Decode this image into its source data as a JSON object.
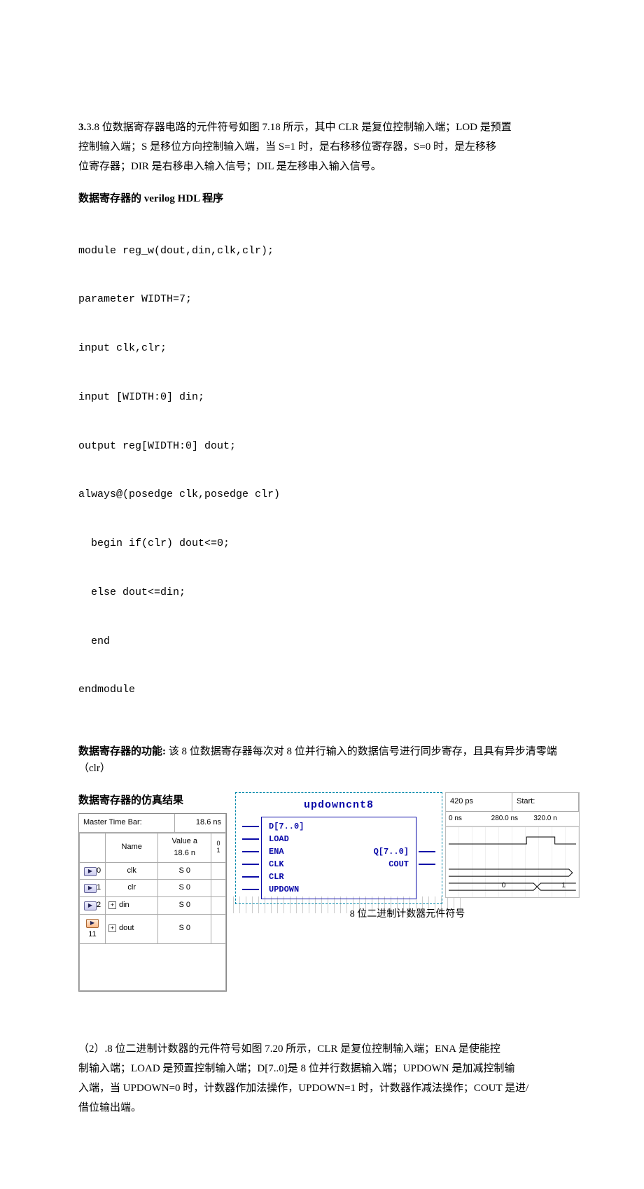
{
  "p1": {
    "l1": "3.8 位数据寄存器电路的元件符号如图 7.18 所示，其中 CLR 是复位控制输入端；LOD 是预置",
    "l2": "控制输入端；S 是移位方向控制输入端，当 S=1 时，是右移移位寄存器，S=0 时，是左移移",
    "l3": "位寄存器；DIR 是右移串入输入信号；DIL 是左移串入输入信号。"
  },
  "h1": "数据寄存器的 verilog HDL 程序",
  "code": {
    "c1": "module reg_w(dout,din,clk,clr);",
    "c2": "parameter WIDTH=7;",
    "c3": "input clk,clr;",
    "c4": "input [WIDTH:0] din;",
    "c5": "output reg[WIDTH:0] dout;",
    "c6": "always@(posedge clk,posedge clr)",
    "c7": "begin if(clr) dout<=0;",
    "c8": "else dout<=din;",
    "c9": "end",
    "c10": "endmodule"
  },
  "func_h": "数据寄存器的功能:",
  "func_t": "该 8 位数据寄存器每次对 8 位并行输入的数据信号进行同步寄存，且具有异步清零端（clr）",
  "sim_h": "数据寄存器的仿真结果",
  "sim": {
    "master_label": "Master Time Bar:",
    "master_val": "18.6 ns",
    "col_name": "Name",
    "col_val_a": "Value a",
    "col_val_b": "18.6 n",
    "col_tick": "0\n1",
    "rows": [
      {
        "idx": "0",
        "name": "clk",
        "val": "S 0"
      },
      {
        "idx": "1",
        "name": "clr",
        "val": "S 0"
      },
      {
        "idx": "2",
        "name": "din",
        "val": "S 0",
        "expand": true
      },
      {
        "idx": "11",
        "name": "dout",
        "val": "S 0",
        "expand": true
      }
    ]
  },
  "schem": {
    "title": "updowncnt8",
    "left": [
      "D[7..0]",
      "LOAD",
      "ENA",
      "CLK",
      "CLR",
      "UPDOWN"
    ],
    "right_q": "Q[7..0]",
    "right_cout": "COUT",
    "caption": "8 位二进制计数器元件符号"
  },
  "wave": {
    "top_l": "420 ps",
    "top_r": "Start:",
    "ticks": [
      "0 ns",
      "280.0 ns",
      "320.0 n"
    ],
    "zero": "0",
    "one": "1"
  },
  "p2": {
    "l1": "（2）.8 位二进制计数器的元件符号如图 7.20 所示，CLR 是复位控制输入端；ENA 是使能控",
    "l2": "制输入端；LOAD 是预置控制输入端；D[7..0]是 8 位并行数据输入端；UPDOWN 是加减控制输",
    "l3": "入端，当 UPDOWN=0 时，计数器作加法操作，UPDOWN=1 时，计数器作减法操作；COUT 是进/",
    "l4": "借位输出端。"
  }
}
